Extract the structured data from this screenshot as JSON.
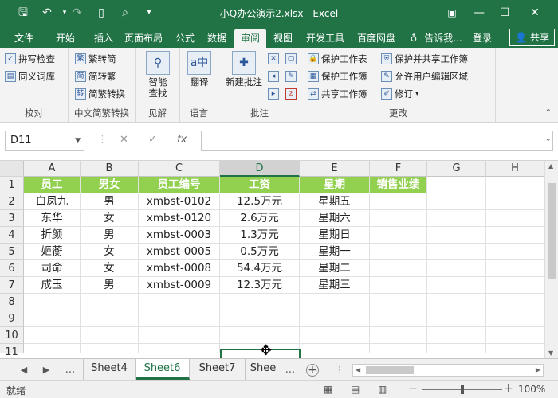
{
  "titlebar": {
    "title": "小Q办公演示2.xlsx - Excel",
    "save_icon": "save-icon",
    "undo_icon": "undo-icon",
    "redo_icon": "redo-icon",
    "new_icon": "new-file-icon",
    "preview_icon": "print-preview-icon",
    "minimize": "—",
    "maximize": "☐",
    "close": "✕"
  },
  "tabs": [
    "文件",
    "开始",
    "插入",
    "页面布局",
    "公式",
    "数据",
    "审阅",
    "视图",
    "开发工具",
    "百度网盘",
    "告诉我...",
    "登录"
  ],
  "share_label": "共享",
  "ribbon": {
    "proofing": {
      "label": "校对",
      "spell": "拼写检查",
      "thesaurus": "同义词库"
    },
    "chinese": {
      "label": "中文简繁转换",
      "t2s": "繁转简",
      "s2t": "简转繁",
      "convert": "简繁转换"
    },
    "insights": {
      "label": "见解",
      "smart": "智能",
      "lookup": "查找"
    },
    "language": {
      "label": "语言",
      "translate": "翻译"
    },
    "comments": {
      "label": "批注",
      "new_comment": "新建批注"
    },
    "changes": {
      "label": "更改",
      "protect_sheet": "保护工作表",
      "protect_book": "保护工作簿",
      "share_book": "共享工作簿",
      "protect_share": "保护并共享工作簿",
      "allow_edit": "允许用户编辑区域",
      "track": "修订"
    }
  },
  "formula": {
    "namebox": "D11",
    "cancel": "✕",
    "enter": "✓",
    "fx": "fx",
    "value": ""
  },
  "columns": [
    "A",
    "B",
    "C",
    "D",
    "E",
    "F",
    "G",
    "H"
  ],
  "rows": [
    "1",
    "2",
    "3",
    "4",
    "5",
    "6",
    "7",
    "8",
    "9",
    "10",
    "11"
  ],
  "header_row": [
    "员工",
    "男女",
    "员工编号",
    "工资",
    "星期",
    "销售业绩"
  ],
  "data_rows": [
    [
      "白凤九",
      "男",
      "xmbst-0102",
      "12.5万元",
      "星期五"
    ],
    [
      "东华",
      "女",
      "xmbst-0120",
      "2.6万元",
      "星期六"
    ],
    [
      "折颜",
      "男",
      "xmbst-0003",
      "1.3万元",
      "星期日"
    ],
    [
      "姬蘅",
      "女",
      "xmbst-0005",
      "0.5万元",
      "星期一"
    ],
    [
      "司命",
      "女",
      "xmbst-0008",
      "54.4万元",
      "星期二"
    ],
    [
      "成玉",
      "男",
      "xmbst-0009",
      "12.3万元",
      "星期三"
    ]
  ],
  "sheets": [
    "Sheet4",
    "Sheet6",
    "Sheet7",
    "Shee"
  ],
  "active_sheet": "Sheet6",
  "sheet_more": "...",
  "status": {
    "ready": "就绪",
    "zoom": "100%",
    "minus": "−",
    "plus": "+"
  }
}
